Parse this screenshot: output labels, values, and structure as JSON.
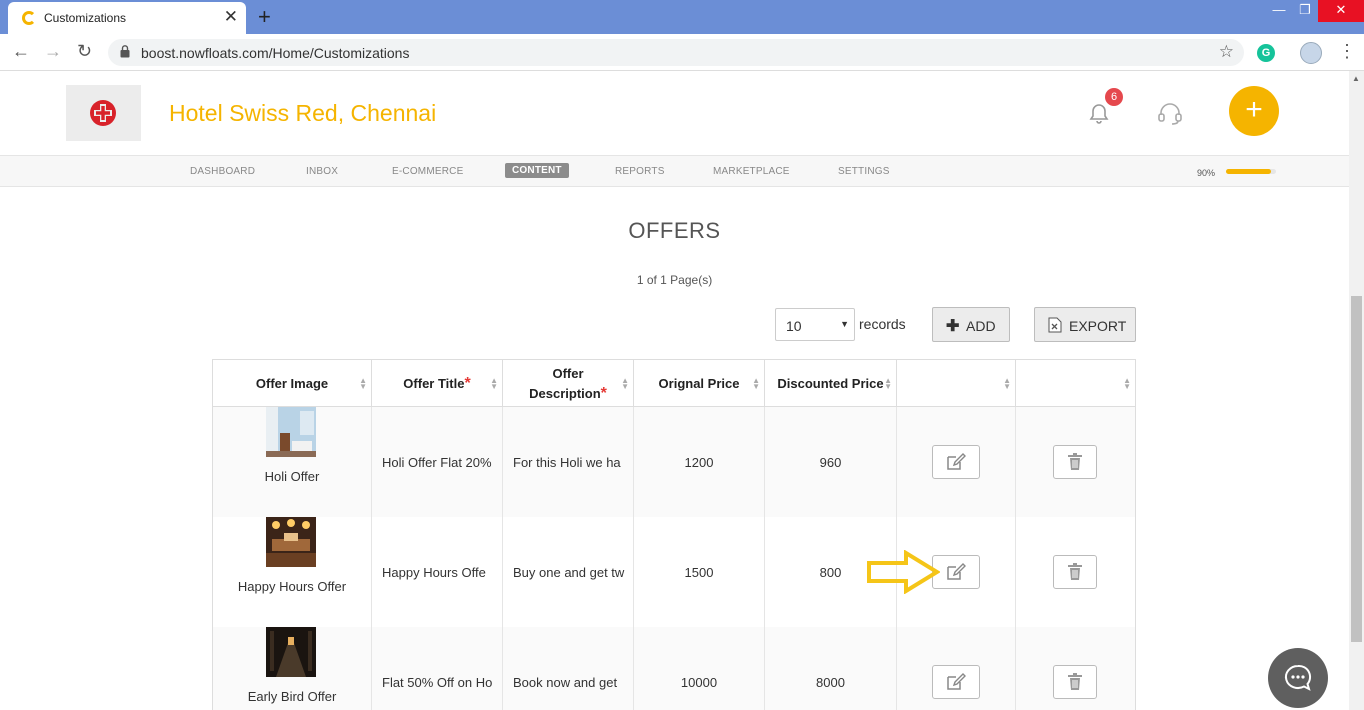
{
  "browser": {
    "tab_title": "Customizations",
    "url": "boost.nowfloats.com/Home/Customizations",
    "extension_letter": "G"
  },
  "header": {
    "hotel_name": "Hotel Swiss Red, Chennai",
    "notification_count": "6",
    "brand_color": "#f5b400"
  },
  "nav": {
    "items": [
      "DASHBOARD",
      "INBOX",
      "E-COMMERCE",
      "CONTENT",
      "REPORTS",
      "MARKETPLACE",
      "SETTINGS"
    ],
    "active": "CONTENT",
    "progress_label": "90%",
    "progress_value": 0.9
  },
  "content": {
    "title": "OFFERS",
    "pagination": "1 of 1 Page(s)",
    "records_value": "10",
    "records_label": "records",
    "add_label": "ADD",
    "export_label": "EXPORT"
  },
  "table": {
    "columns": [
      "Offer Image",
      "Offer Title",
      "Offer Description",
      "Orignal Price",
      "Discounted Price",
      "",
      ""
    ],
    "required_columns": [
      "Offer Title",
      "Offer Description"
    ],
    "rows": [
      {
        "image_name": "Holi Offer",
        "title": "Holi Offer Flat 20%",
        "description": "For this Holi we ha",
        "original_price": "1200",
        "discounted_price": "960"
      },
      {
        "image_name": "Happy Hours Offer",
        "title": "Happy Hours Offe",
        "description": "Buy one and get tw",
        "original_price": "1500",
        "discounted_price": "800"
      },
      {
        "image_name": "Early Bird Offer",
        "title": "Flat 50% Off on Ho",
        "description": "Book now and get",
        "original_price": "10000",
        "discounted_price": "8000"
      }
    ]
  }
}
